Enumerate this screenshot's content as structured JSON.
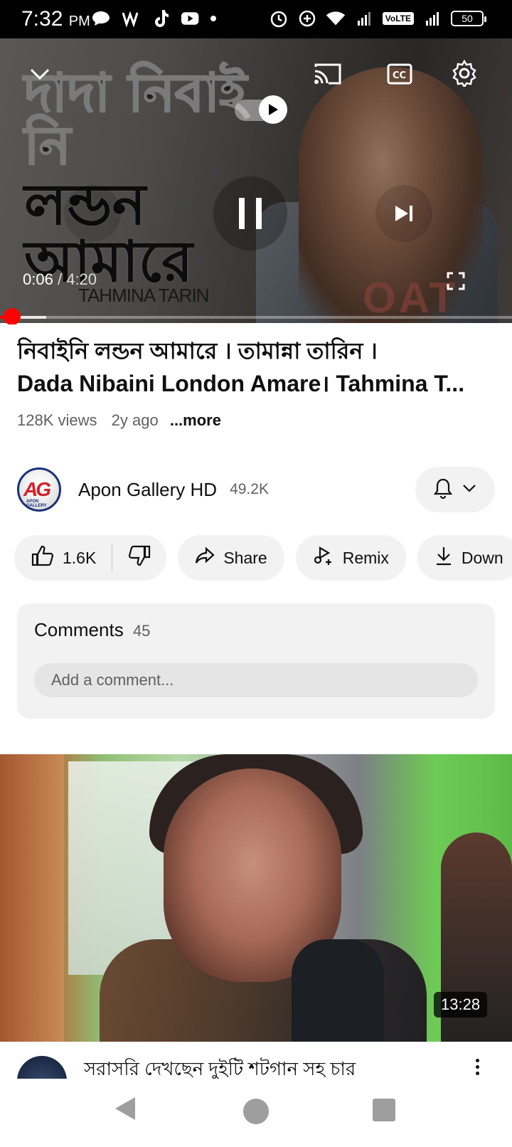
{
  "status_bar": {
    "time": "7:32",
    "ampm": "PM",
    "network_label": "VoLTE",
    "battery": "50"
  },
  "player": {
    "overlay_title_line1": "দাদা নিবাই নি",
    "overlay_title_line2": "লন্ডন আমারে",
    "overlay_artist": "TAHMINA TARIN",
    "current_time": "0:06",
    "separator": "/",
    "duration": "4:20",
    "progress_fraction": 0.023,
    "buffered_fraction": 0.09,
    "shirt_text": "OAT"
  },
  "video": {
    "title_line1": "নিবাইনি লন্ডন আমারে । তামান্না তারিন ।",
    "title_line2": "Dada Nibaini London Amare। Tahmina T...",
    "views": "128K views",
    "age": "2y ago",
    "more": "...more"
  },
  "channel": {
    "avatar_text": "AG",
    "avatar_subtext": "APON GALLERY",
    "name": "Apon Gallery HD",
    "subscribers": "49.2K"
  },
  "actions": {
    "likes": "1.6K",
    "share": "Share",
    "remix": "Remix",
    "download": "Down"
  },
  "comments": {
    "header": "Comments",
    "count": "45",
    "placeholder": "Add a comment..."
  },
  "next_video": {
    "duration": "13:28",
    "title": "সরাসরি দেখছেন দুইটি শটগান সহ চার"
  },
  "colors": {
    "accent_red": "#ff0000",
    "pill_bg": "#f2f2f2",
    "secondary_text": "#606060"
  }
}
